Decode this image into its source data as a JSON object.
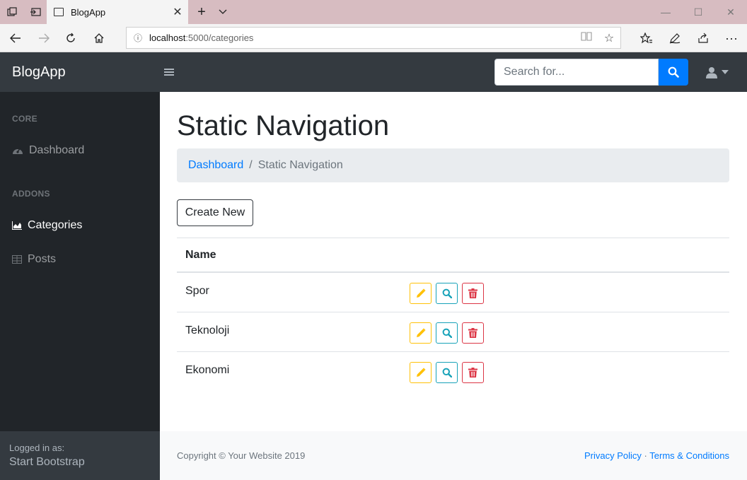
{
  "browser": {
    "tab_title": "BlogApp",
    "url_host": "localhost",
    "url_path": ":5000/categories"
  },
  "topnav": {
    "brand": "BlogApp",
    "search_placeholder": "Search for..."
  },
  "sidebar": {
    "sections": [
      {
        "heading": "CORE",
        "items": [
          {
            "label": "Dashboard",
            "icon": "dashboard-gauge-icon"
          }
        ]
      },
      {
        "heading": "ADDONS",
        "items": [
          {
            "label": "Categories",
            "icon": "area-chart-icon",
            "active": true
          },
          {
            "label": "Posts",
            "icon": "table-icon"
          }
        ]
      }
    ],
    "footer": {
      "logged_in_label": "Logged in as:",
      "user": "Start Bootstrap"
    }
  },
  "main": {
    "title": "Static Navigation",
    "breadcrumb": {
      "link": "Dashboard",
      "separator": "/",
      "active": "Static Navigation"
    },
    "create_button": "Create New",
    "table": {
      "header": "Name",
      "rows": [
        "Spor",
        "Teknoloji",
        "Ekonomi"
      ],
      "action_icons": [
        "pencil-icon",
        "search-icon",
        "trash-icon"
      ]
    }
  },
  "footer": {
    "copyright": "Copyright © Your Website 2019",
    "privacy": "Privacy Policy",
    "dot": "·",
    "terms": "Terms & Conditions"
  },
  "colors": {
    "primary": "#007bff",
    "warning": "#ffc107",
    "info": "#17a2b8",
    "danger": "#dc3545",
    "sidebar_bg": "#212529",
    "topnav_bg": "#343a40"
  }
}
